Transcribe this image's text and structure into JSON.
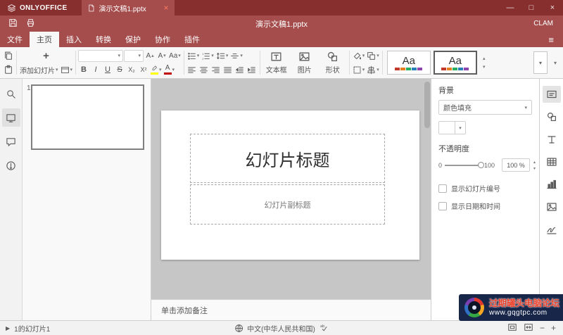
{
  "colors": {
    "accent": "#a54c4c",
    "titlebar": "#872e2e",
    "highlight": "#ffff00",
    "font_color": "#c00000",
    "watermark_bg": "#172649",
    "watermark_title": "#e8402a",
    "theme_palette": [
      "#c0392b",
      "#e67e22",
      "#27ae60",
      "#2980b9",
      "#8e44ad"
    ]
  },
  "titlebar": {
    "app_name": "ONLYOFFICE",
    "tab_title": "演示文稿1.pptx"
  },
  "header": {
    "document_title": "演示文稿1.pptx",
    "user_name": "CLAM"
  },
  "menu": {
    "items": [
      {
        "label": "文件"
      },
      {
        "label": "主页"
      },
      {
        "label": "插入"
      },
      {
        "label": "转换"
      },
      {
        "label": "保护"
      },
      {
        "label": "协作"
      },
      {
        "label": "插件"
      }
    ]
  },
  "toolbar": {
    "add_slide_label": "添加幻灯片",
    "font_name_value": "",
    "font_size_value": "",
    "grow_glyph": "A",
    "shrink_glyph": "A",
    "case_glyph": "Aa",
    "bold": "B",
    "italic": "I",
    "underline": "U",
    "strikeout": "S",
    "subscript": "X₂",
    "superscript": "X²",
    "text_box_label": "文本框",
    "image_label": "图片",
    "shape_label": "形状",
    "theme_label": "Aa"
  },
  "icons": {
    "caret_down": "▾",
    "caret_up": "▴",
    "plus": "+",
    "hamburger": "≡",
    "minimize": "—",
    "maximize": "□",
    "close": "×",
    "play": "▶",
    "zoom_out": "−",
    "zoom_in": "+"
  },
  "slide_panel": {
    "slide_number": "1"
  },
  "slide": {
    "title_placeholder": "幻灯片标题",
    "subtitle_placeholder": "幻灯片副标题"
  },
  "notes": {
    "placeholder": "单击添加备注"
  },
  "right_panel": {
    "background_label": "背景",
    "fill_type_value": "颜色填充",
    "opacity_label": "不透明度",
    "opacity_min": "0",
    "opacity_max": "100",
    "opacity_value": "100 %",
    "show_slide_number_label": "显示幻灯片编号",
    "show_date_time_label": "显示日期和时间"
  },
  "statusbar": {
    "slide_info": "1的幻灯片1",
    "language": "中文(中华人民共和国)"
  },
  "watermark": {
    "line1": "过期罐头电脑论坛",
    "line2": "www.gqgtpc.com"
  }
}
